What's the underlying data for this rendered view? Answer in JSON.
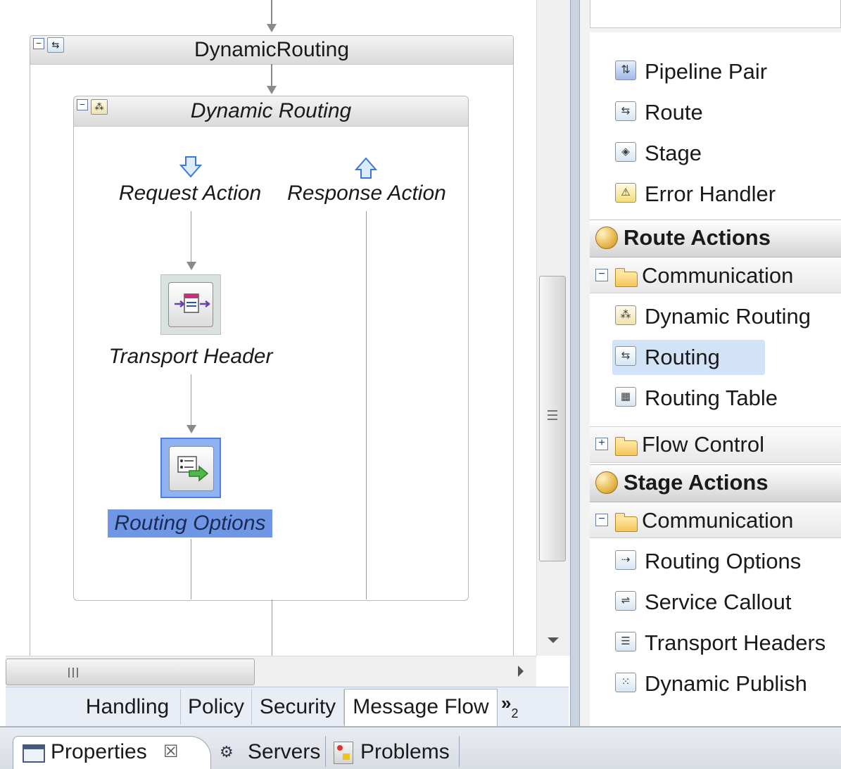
{
  "canvas": {
    "outer_stage": {
      "title": "DynamicRouting"
    },
    "inner_action": {
      "title": "Dynamic Routing"
    },
    "request_label": "Request Action",
    "response_label": "Response Action",
    "transport_header_label": "Transport Header",
    "routing_options_label": "Routing Options"
  },
  "editor_tabs": [
    "Handling",
    "Policy",
    "Security",
    "Message Flow"
  ],
  "editor_tabs_overflow": "»",
  "editor_tabs_overflow_count": "2",
  "bottom_views": {
    "properties": "Properties",
    "servers": "Servers",
    "problems": "Problems"
  },
  "palette": {
    "items_top": [
      "Pipeline Pair",
      "Route",
      "Stage",
      "Error Handler"
    ],
    "route_actions": {
      "title": "Route Actions",
      "folder": "Communication",
      "items": [
        "Dynamic Routing",
        "Routing",
        "Routing Table"
      ],
      "selected": "Routing"
    },
    "flow_control": {
      "folder": "Flow Control"
    },
    "stage_actions": {
      "title": "Stage Actions",
      "folder": "Communication",
      "items": [
        "Routing Options",
        "Service Callout",
        "Transport Headers",
        "Dynamic Publish"
      ]
    }
  },
  "colors": {
    "selection_highlight": "#6f97e6",
    "palette_selection": "#d3e3f7",
    "tab_active": "#ffffff"
  }
}
